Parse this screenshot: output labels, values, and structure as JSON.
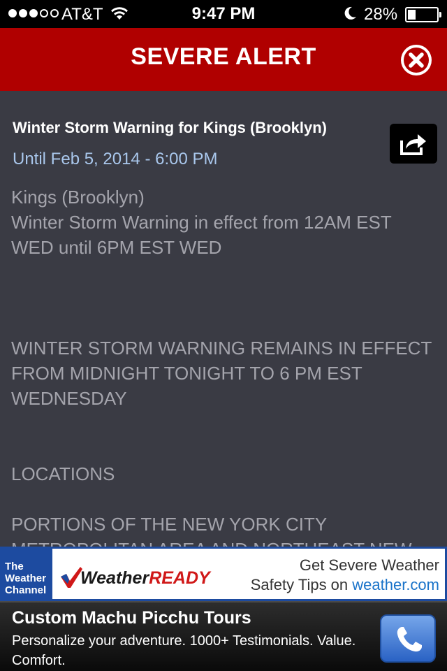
{
  "status_bar": {
    "carrier": "AT&T",
    "time": "9:47 PM",
    "battery_text": "28%",
    "battery_level": 0.28,
    "signal_bars_filled": 3,
    "signal_bars_total": 5
  },
  "header": {
    "title": "SEVERE ALERT",
    "accent_color": "#b00000"
  },
  "alert": {
    "title": "Winter Storm Warning for Kings (Brooklyn)",
    "until": "Until Feb 5, 2014 - 6:00 PM",
    "body": [
      "Kings (Brooklyn)",
      "Winter Storm Warning in effect from 12AM EST WED until 6PM EST WED",
      "",
      "",
      "",
      "WINTER STORM WARNING REMAINS IN EFFECT FROM MIDNIGHT TONIGHT TO 6 PM EST WEDNESDAY",
      "",
      "",
      "LOCATIONS",
      "",
      "PORTIONS OF THE NEW YORK CITY METROPOLITAN AREA AND NORTHEAST NEW"
    ]
  },
  "banner": {
    "twc_logo": [
      "The",
      "Weather",
      "Channel"
    ],
    "wr_weather": "Weather",
    "wr_ready": "READY",
    "line1": "Get Severe Weather",
    "line2_prefix": "Safety Tips on ",
    "line2_link": "weather.com"
  },
  "ad": {
    "title": "Custom Machu Picchu Tours",
    "description": "Personalize your adventure. 1000+ Testimonials. Value. Comfort."
  },
  "icons": {
    "close": "close-icon",
    "share": "share-icon",
    "phone": "phone-icon",
    "wifi": "wifi-icon",
    "moon": "moon-icon"
  }
}
